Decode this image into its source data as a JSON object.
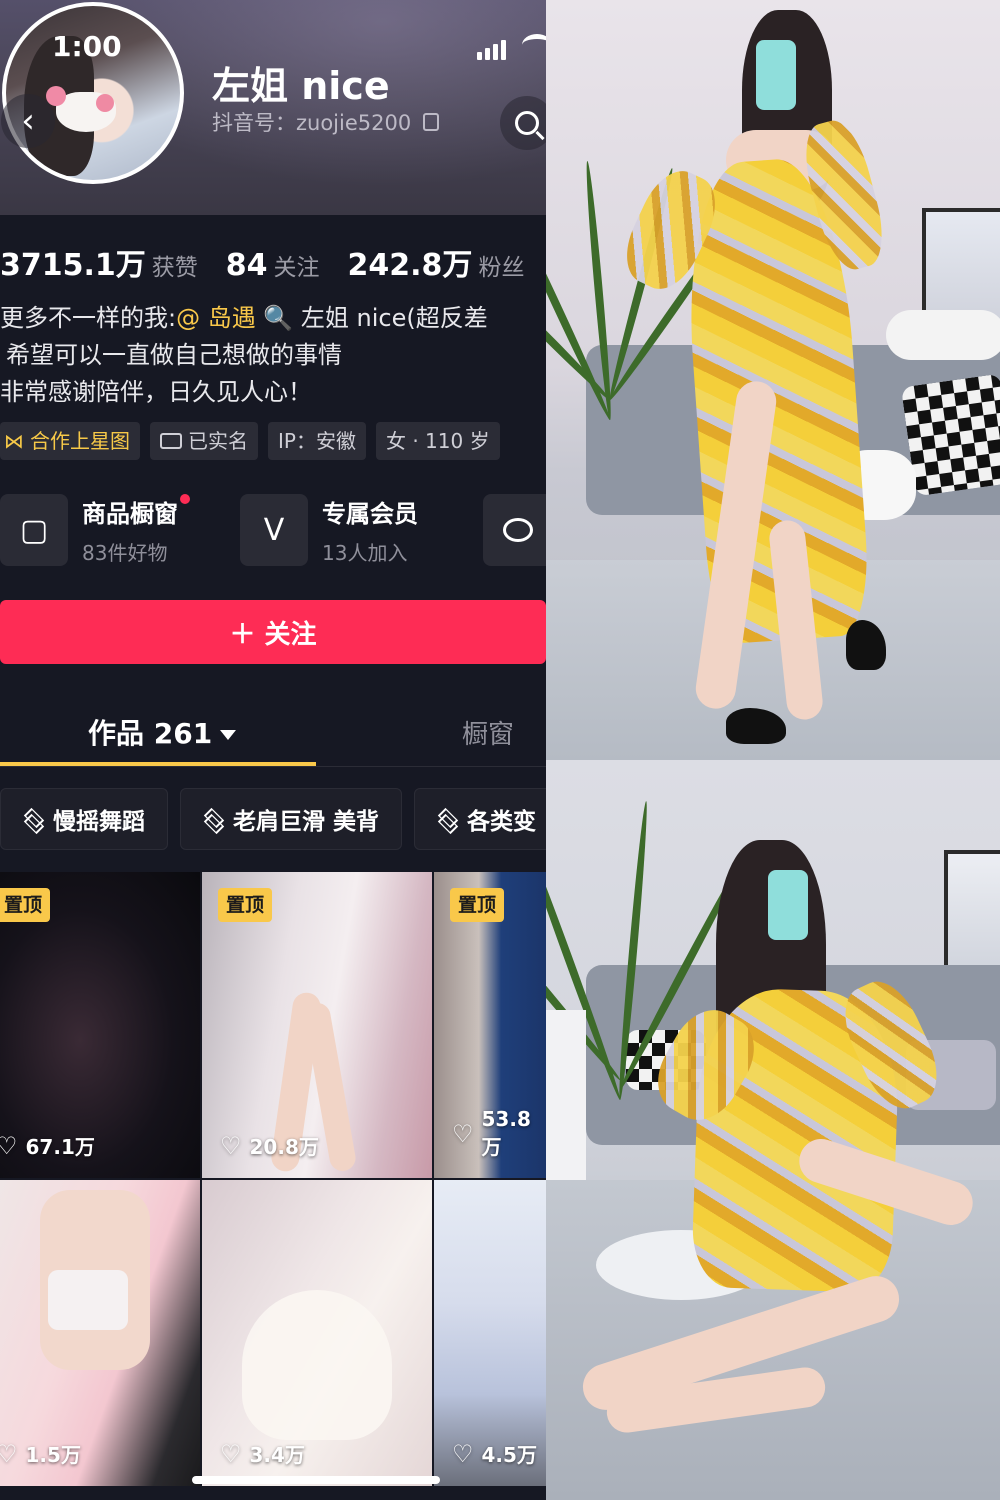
{
  "status_bar": {
    "time": "1:00"
  },
  "profile": {
    "nickname": "左姐 nice",
    "douyin_id": "抖音号：zuojie5200",
    "stats": [
      {
        "value": "3715.1万",
        "label": "获赞"
      },
      {
        "value": "84",
        "label": "关注"
      },
      {
        "value": "242.8万",
        "label": "粉丝"
      }
    ],
    "bio": {
      "line1_prefix": "更多不一样的我:",
      "line1_mention": "@ 岛遇",
      "line1_suffix": " 🔍 左姐 nice(超反差",
      "line2": "希望可以一直做自己想做的事情",
      "line3": "非常感谢陪伴，日久见人心！"
    },
    "tags": [
      {
        "label": "合作上星图",
        "icon": "star-map-icon"
      },
      {
        "label": "已实名",
        "icon": "id-card-icon"
      },
      {
        "label": "IP：安徽"
      },
      {
        "label": "女 · 110 岁"
      }
    ],
    "cards": {
      "shop": {
        "title": "商品橱窗",
        "subtitle": "83件好物",
        "icon": "shopping-bag-icon"
      },
      "member": {
        "title": "专属会员",
        "subtitle": "13人加入",
        "icon": "vip-v-icon"
      },
      "message_icon": "chat-bubble-icon"
    },
    "follow_label": "＋ 关注"
  },
  "tabs": {
    "works": "作品 261",
    "shop": "橱窗"
  },
  "collections": [
    {
      "label": "慢摇舞蹈"
    },
    {
      "label": "老肩巨滑 美背"
    },
    {
      "label": "各类变"
    }
  ],
  "videos": [
    {
      "pinned": "置顶",
      "likes": "67.1万"
    },
    {
      "pinned": "置顶",
      "likes": "20.8万"
    },
    {
      "pinned": "置顶",
      "likes": "53.8万"
    },
    {
      "pinned": "",
      "likes": "1.5万"
    },
    {
      "pinned": "",
      "likes": "3.4万"
    },
    {
      "pinned": "",
      "likes": "4.5万"
    }
  ],
  "colors": {
    "accent_red": "#fe2c55",
    "accent_yellow": "#f9c84a",
    "background": "#161823"
  }
}
